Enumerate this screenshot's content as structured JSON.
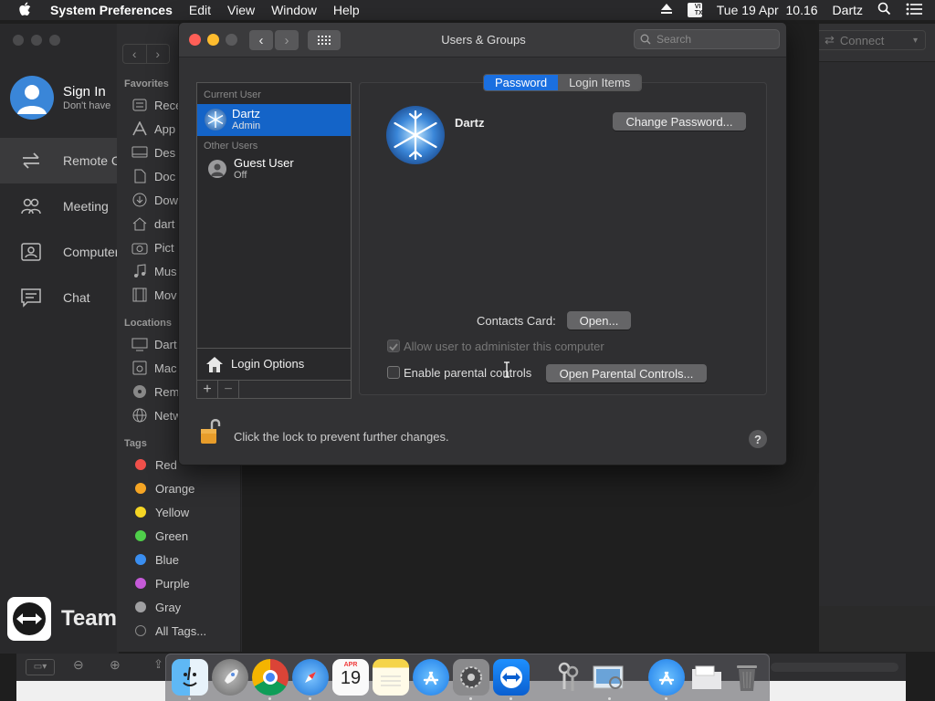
{
  "menubar": {
    "apple": "",
    "app_name": "System Preferences",
    "menus": [
      "Edit",
      "View",
      "Window",
      "Help"
    ],
    "input_source": "VI\nTX",
    "clock": "Tue 19 Apr  10.16",
    "user": "Dartz"
  },
  "teamviewer": {
    "signin_title": "Sign In",
    "signin_sub": "Don't have",
    "nav": [
      "Remote C",
      "Meeting",
      "Computer",
      "Chat"
    ],
    "brand": "Team",
    "connect_label": "Connect"
  },
  "finder": {
    "favorites_header": "Favorites",
    "favorites": [
      "Rece",
      "App",
      "Des",
      "Doc",
      "Dow",
      "dart",
      "Pict",
      "Mus",
      "Mov"
    ],
    "locations_header": "Locations",
    "locations": [
      "Dart",
      "Mac",
      "Rem",
      "Netw"
    ],
    "tags_header": "Tags",
    "tags": [
      {
        "label": "Red",
        "color": "#f0504a"
      },
      {
        "label": "Orange",
        "color": "#f5a524"
      },
      {
        "label": "Yellow",
        "color": "#f5d524"
      },
      {
        "label": "Green",
        "color": "#4fcf4a"
      },
      {
        "label": "Blue",
        "color": "#3a8ef0"
      },
      {
        "label": "Purple",
        "color": "#c55ad8"
      },
      {
        "label": "Gray",
        "color": "#a0a0a2"
      }
    ],
    "all_tags": "All Tags..."
  },
  "sysprefs": {
    "title": "Users & Groups",
    "search_placeholder": "Search",
    "current_user_header": "Current User",
    "current_user": {
      "name": "Dartz",
      "role": "Admin"
    },
    "other_users_header": "Other Users",
    "guest_user": {
      "name": "Guest User",
      "status": "Off"
    },
    "login_options": "Login Options",
    "add_button": "+",
    "remove_button": "−",
    "tabs": [
      "Password",
      "Login Items"
    ],
    "active_tab": "Password",
    "user_display_name": "Dartz",
    "change_password": "Change Password...",
    "contacts_card_label": "Contacts Card:",
    "open_button": "Open...",
    "allow_admin_label": "Allow user to administer this computer",
    "allow_admin_checked": true,
    "parental_label": "Enable parental controls",
    "parental_checked": false,
    "open_parental_button": "Open Parental Controls...",
    "lock_text": "Click the lock to prevent further changes.",
    "help": "?"
  },
  "dock": {
    "items": [
      "finder",
      "launchpad",
      "chrome",
      "safari",
      "calendar",
      "notes",
      "app-store",
      "system-preferences",
      "teamviewer",
      "keychain-access",
      "preview",
      "app-store-downloads",
      "documents-folder",
      "trash"
    ],
    "calendar_month": "APR",
    "calendar_day": "19"
  },
  "colors": {
    "accent": "#1a6fe0",
    "close": "#fe5f57",
    "minimize": "#febc2e"
  }
}
